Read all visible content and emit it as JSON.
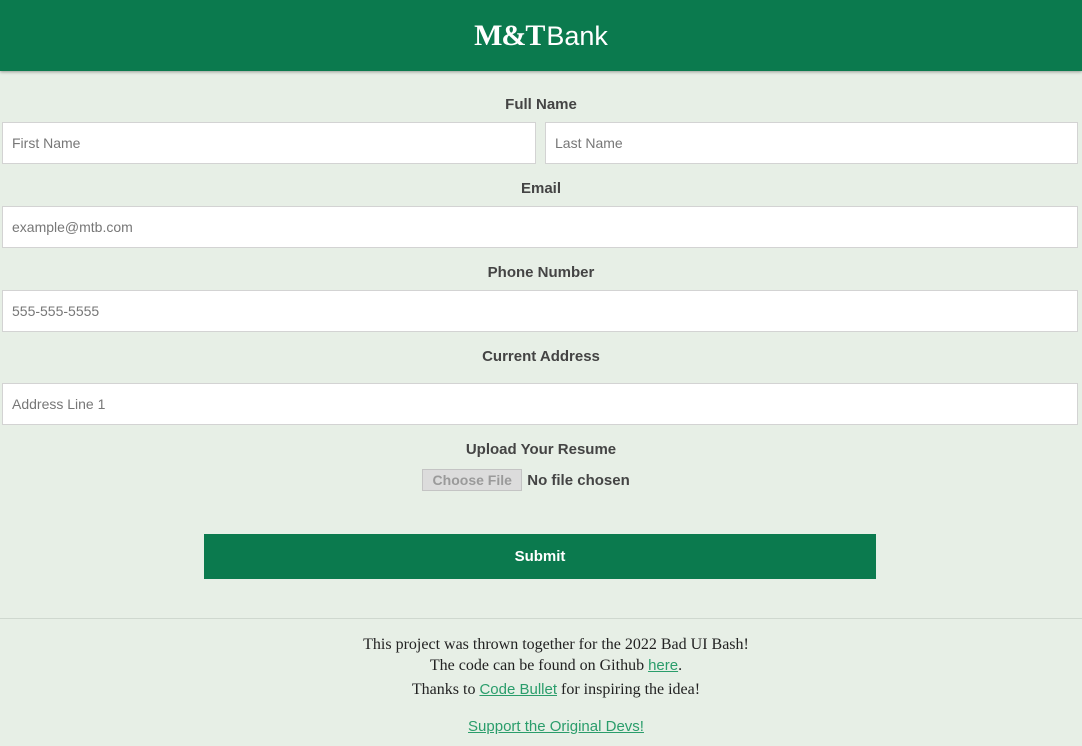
{
  "header": {
    "logo_mark": "M&T",
    "logo_word": "Bank",
    "background_color": "#0b7a4e"
  },
  "form": {
    "full_name": {
      "label": "Full Name",
      "first_placeholder": "First Name",
      "last_placeholder": "Last Name",
      "first_value": "",
      "last_value": ""
    },
    "email": {
      "label": "Email",
      "placeholder": "example@mtb.com",
      "value": ""
    },
    "phone": {
      "label": "Phone Number",
      "placeholder": "555-555-5555",
      "value": ""
    },
    "address": {
      "label": "Current Address",
      "placeholder": "Address Line 1",
      "value": ""
    },
    "resume": {
      "label": "Upload Your Resume",
      "button_label": "Choose File",
      "status": "No file chosen"
    },
    "submit_label": "Submit"
  },
  "footer": {
    "line1": "This project was thrown together for the 2022 Bad UI Bash!",
    "line2_prefix": "The code can be found on Github ",
    "line2_link": "here",
    "line2_suffix": ".",
    "line3_prefix": "Thanks to ",
    "line3_link": "Code Bullet",
    "line3_suffix": " for inspiring the idea!",
    "support_link": "Support the Original Devs!"
  },
  "colors": {
    "accent": "#0b7a4e",
    "page_background": "#e7efe6",
    "link": "#2a9d6b"
  }
}
